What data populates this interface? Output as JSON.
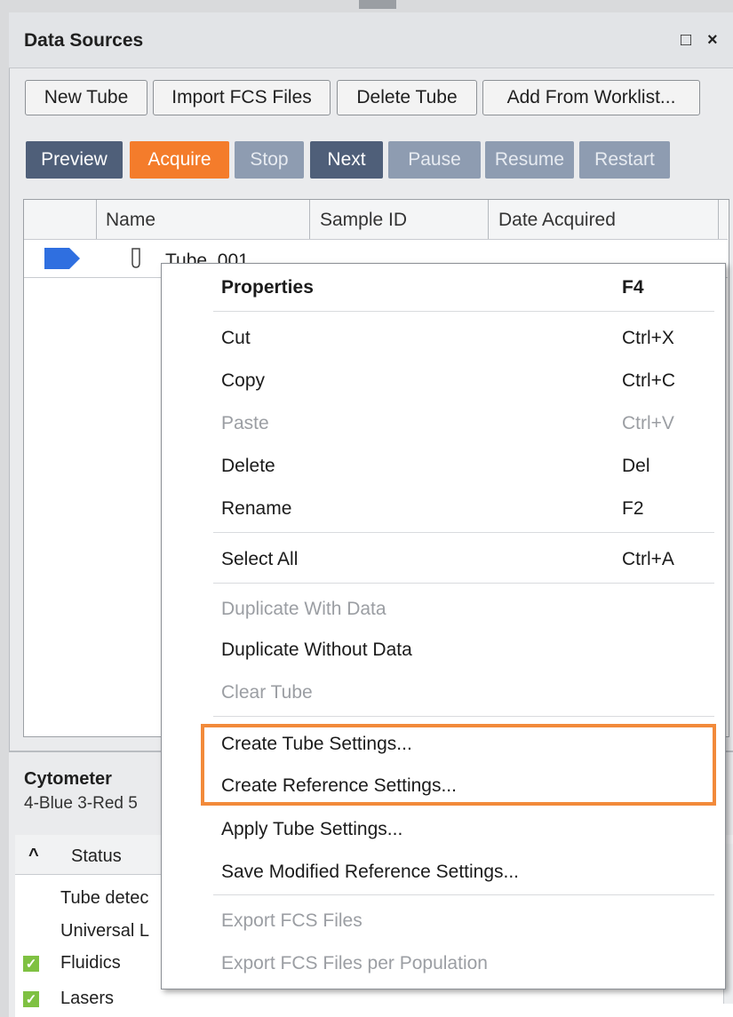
{
  "panel": {
    "title": "Data Sources",
    "maximize_glyph": "□",
    "close_glyph": "×"
  },
  "toolbar": {
    "new_tube": "New Tube",
    "import_fcs": "Import FCS Files",
    "delete_tube": "Delete Tube",
    "add_worklist": "Add From Worklist..."
  },
  "controls": {
    "preview": "Preview",
    "acquire": "Acquire",
    "stop": "Stop",
    "next": "Next",
    "pause": "Pause",
    "resume": "Resume",
    "restart": "Restart"
  },
  "table": {
    "headers": [
      "Name",
      "Sample ID",
      "Date Acquired"
    ],
    "row_name": "Tube_001"
  },
  "cytometer": {
    "title": "Cytometer",
    "config": "4-Blue 3-Red 5",
    "status_header": "Status",
    "rows": [
      "Tube detec",
      "Universal L",
      "Fluidics",
      "Lasers"
    ]
  },
  "menu": {
    "items": [
      {
        "label": "Properties",
        "shortcut": "F4"
      },
      {
        "label": "Cut",
        "shortcut": "Ctrl+X"
      },
      {
        "label": "Copy",
        "shortcut": "Ctrl+C"
      },
      {
        "label": "Paste",
        "shortcut": "Ctrl+V"
      },
      {
        "label": "Delete",
        "shortcut": "Del"
      },
      {
        "label": "Rename",
        "shortcut": "F2"
      },
      {
        "label": "Select All",
        "shortcut": "Ctrl+A"
      },
      {
        "label": "Duplicate With Data"
      },
      {
        "label": "Duplicate Without Data"
      },
      {
        "label": "Clear Tube"
      },
      {
        "label": "Create Tube Settings..."
      },
      {
        "label": "Create Reference Settings..."
      },
      {
        "label": "Apply Tube Settings..."
      },
      {
        "label": "Save Modified Reference Settings..."
      },
      {
        "label": "Export FCS Files"
      },
      {
        "label": "Export FCS Files per Population"
      }
    ]
  },
  "colors": {
    "accent_orange": "#f47c2b",
    "control_dark": "#4f5f79",
    "highlight_box": "#f28a3a",
    "check_green": "#7fc142",
    "current_marker": "#2f6fe0"
  }
}
